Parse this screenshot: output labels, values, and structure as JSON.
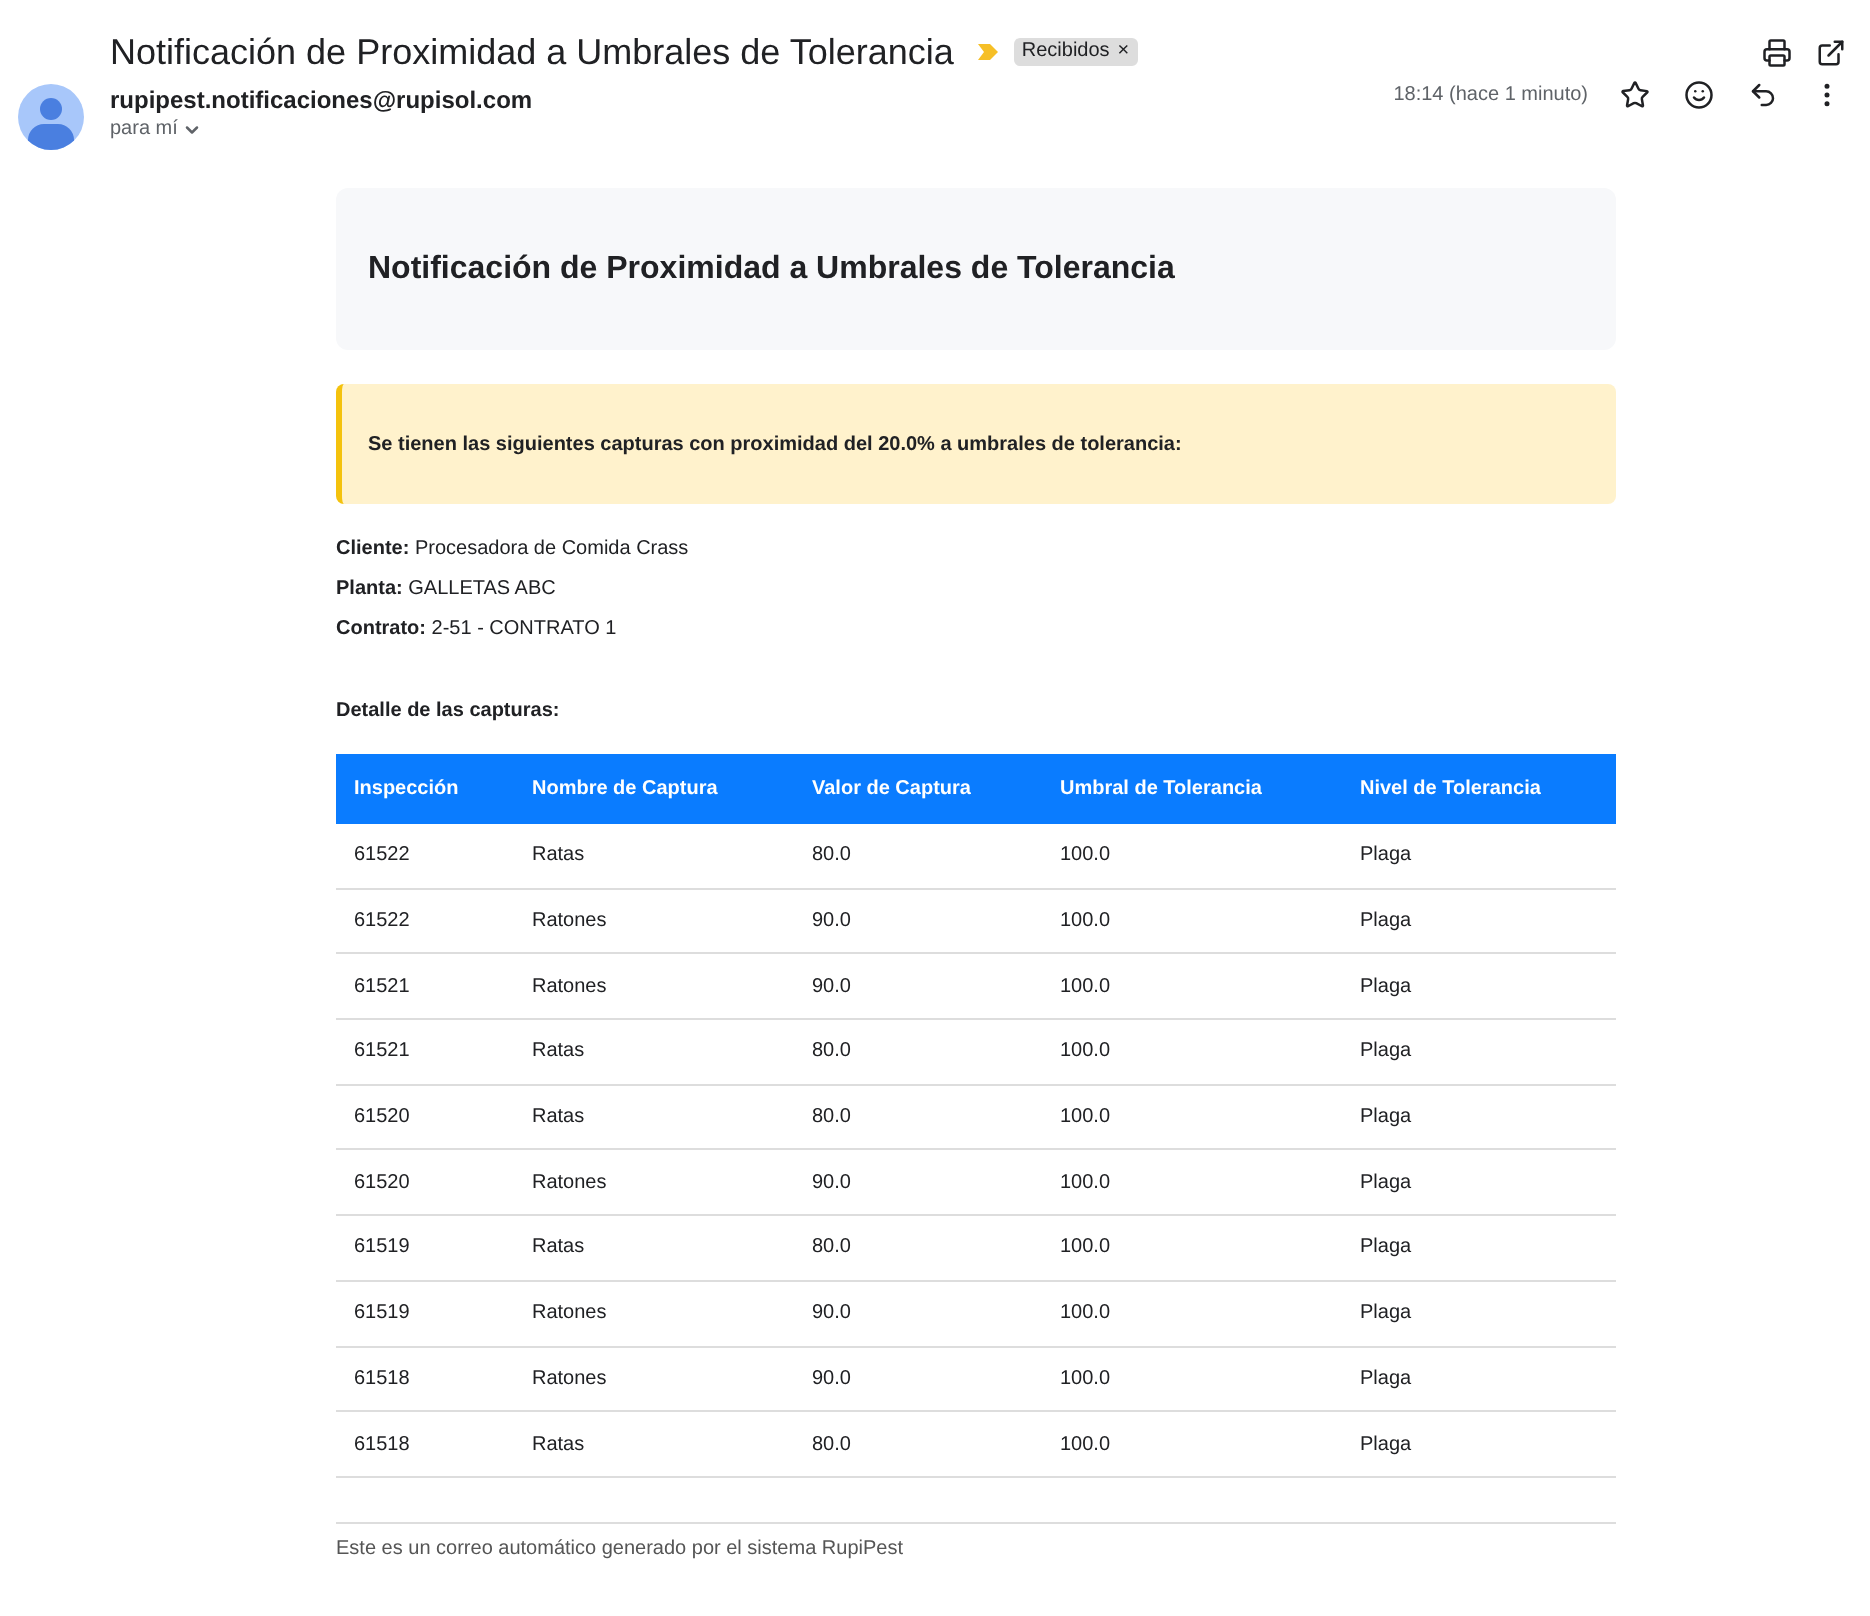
{
  "email": {
    "subject": "Notificación de Proximidad a Umbrales de Tolerancia",
    "label": {
      "text": "Recibidos",
      "close": "×"
    },
    "sender": "rupipest.notificaciones@rupisol.com",
    "recipient": "para mí",
    "time": "18:14 (hace 1 minuto)"
  },
  "body": {
    "heading": "Notificación de Proximidad a Umbrales de Tolerancia",
    "alert": "Se tienen las siguientes capturas con proximidad del 20.0% a umbrales de tolerancia:",
    "info": [
      {
        "label": "Cliente:",
        "value": "Procesadora de Comida Crass"
      },
      {
        "label": "Planta:",
        "value": "GALLETAS ABC"
      },
      {
        "label": "Contrato:",
        "value": "2-51 - CONTRATO 1"
      }
    ],
    "detail_title": "Detalle de las capturas:",
    "table": {
      "columns": [
        "Inspección",
        "Nombre de Captura",
        "Valor de Captura",
        "Umbral de Tolerancia",
        "Nivel de Tolerancia"
      ],
      "rows": [
        [
          "61522",
          "Ratas",
          "80.0",
          "100.0",
          "Plaga"
        ],
        [
          "61522",
          "Ratones",
          "90.0",
          "100.0",
          "Plaga"
        ],
        [
          "61521",
          "Ratones",
          "90.0",
          "100.0",
          "Plaga"
        ],
        [
          "61521",
          "Ratas",
          "80.0",
          "100.0",
          "Plaga"
        ],
        [
          "61520",
          "Ratas",
          "80.0",
          "100.0",
          "Plaga"
        ],
        [
          "61520",
          "Ratones",
          "90.0",
          "100.0",
          "Plaga"
        ],
        [
          "61519",
          "Ratas",
          "80.0",
          "100.0",
          "Plaga"
        ],
        [
          "61519",
          "Ratones",
          "90.0",
          "100.0",
          "Plaga"
        ],
        [
          "61518",
          "Ratones",
          "90.0",
          "100.0",
          "Plaga"
        ],
        [
          "61518",
          "Ratas",
          "80.0",
          "100.0",
          "Plaga"
        ]
      ]
    },
    "footer": "Este es un correo automático generado por el sistema RupiPest"
  }
}
